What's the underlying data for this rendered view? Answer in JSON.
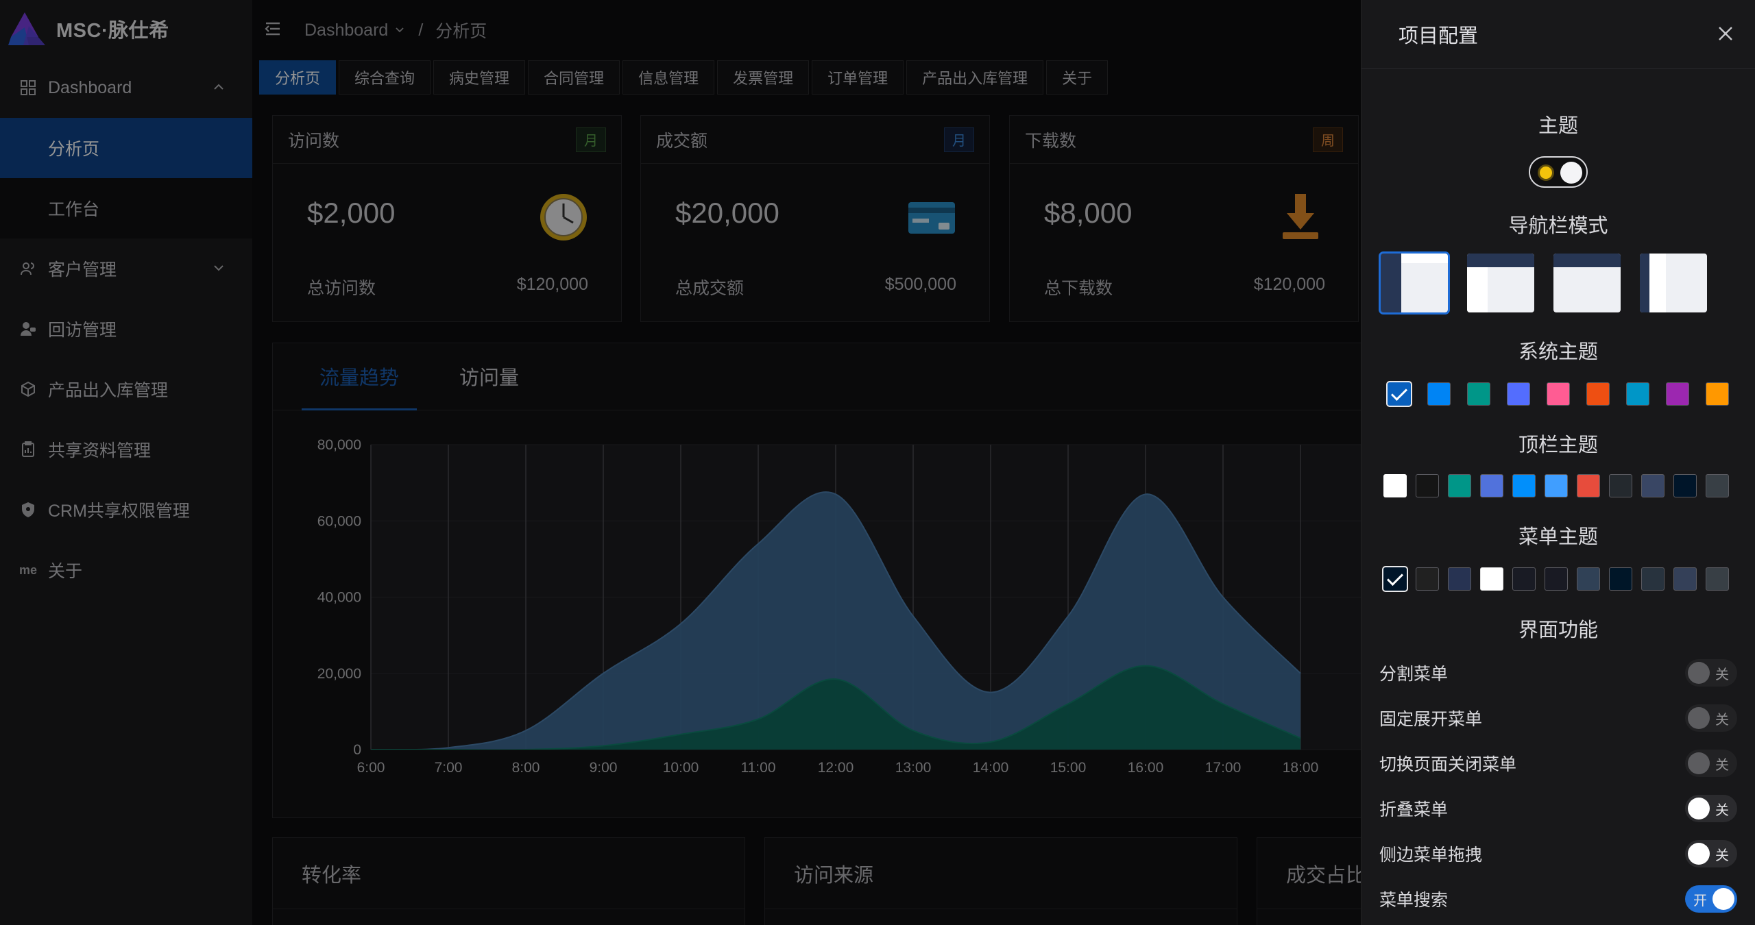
{
  "app": {
    "name": "MSC·脉仕希"
  },
  "sidebar": {
    "items": [
      {
        "label": "Dashboard",
        "icon": "grid-icon"
      },
      {
        "label": "分析页"
      },
      {
        "label": "工作台"
      },
      {
        "label": "客户管理",
        "icon": "user-group-icon"
      },
      {
        "label": "回访管理",
        "icon": "user-chat-icon"
      },
      {
        "label": "产品出入库管理",
        "icon": "box-icon"
      },
      {
        "label": "共享资料管理",
        "icon": "clipboard-icon"
      },
      {
        "label": "CRM共享权限管理",
        "icon": "shield-icon"
      },
      {
        "label": "关于",
        "icon_text": "me"
      }
    ]
  },
  "header": {
    "breadcrumb": [
      "Dashboard",
      "分析页"
    ],
    "separator": "/"
  },
  "tabs": [
    "分析页",
    "综合查询",
    "病史管理",
    "合同管理",
    "信息管理",
    "发票管理",
    "订单管理",
    "产品出入库管理",
    "关于"
  ],
  "stats": [
    {
      "title": "访问数",
      "badge": "月",
      "value": "$2,000",
      "foot_label": "总访问数",
      "foot_value": "$120,000",
      "color": "#5ba14b"
    },
    {
      "title": "成交额",
      "badge": "月",
      "value": "$20,000",
      "foot_label": "总成交额",
      "foot_value": "$500,000",
      "color": "#3a86d6"
    },
    {
      "title": "下载数",
      "badge": "周",
      "value": "$8,000",
      "foot_label": "总下载数",
      "foot_value": "$120,000",
      "color": "#d9843a"
    }
  ],
  "chart_tabs": [
    "流量趋势",
    "访问量"
  ],
  "bottom_cards": [
    "转化率",
    "访问来源",
    "成交占比"
  ],
  "chart_data": {
    "type": "area",
    "x": [
      "6:00",
      "7:00",
      "8:00",
      "9:00",
      "10:00",
      "11:00",
      "12:00",
      "13:00",
      "14:00",
      "15:00",
      "16:00",
      "17:00",
      "18:00"
    ],
    "ylim": [
      0,
      80000
    ],
    "yticks": [
      "0",
      "20,000",
      "40,000",
      "60,000",
      "80,000"
    ],
    "grid": true,
    "series": [
      {
        "values": [
          0,
          500,
          5000,
          20000,
          33000,
          54000,
          67000,
          35000,
          15000,
          35000,
          67000,
          40000,
          20000
        ],
        "color": "#3f6d99"
      },
      {
        "values": [
          0,
          0,
          0,
          1000,
          4000,
          8000,
          18500,
          5000,
          2000,
          12000,
          22000,
          12000,
          3000
        ],
        "color": "#0f6a5c"
      }
    ]
  },
  "drawer": {
    "title": "项目配置",
    "sections": {
      "theme": "主题",
      "nav_mode": "导航栏模式",
      "system_theme": "系统主题",
      "top_theme": "顶栏主题",
      "menu_theme": "菜单主题",
      "features": "界面功能"
    },
    "system_colors": [
      "#0960bd",
      "#0084f4",
      "#009688",
      "#536dfe",
      "#ff5c93",
      "#ee4f12",
      "#0096c7",
      "#9c27b0",
      "#ff9800"
    ],
    "top_colors": [
      "#ffffff",
      "#151515",
      "#009688",
      "#5172dc",
      "#018ffb",
      "#409eff",
      "#e74c3c",
      "#24292e",
      "#394664",
      "#001529",
      "#383f45"
    ],
    "menu_colors": [
      "#001529",
      "#212121",
      "#273352",
      "#ffffff",
      "#191b24",
      "#191a23",
      "#304156",
      "#001628",
      "#28333e",
      "#344058",
      "#383f45"
    ],
    "features": [
      {
        "label": "分割菜单",
        "state": "关",
        "on": false,
        "disabled": true
      },
      {
        "label": "固定展开菜单",
        "state": "关",
        "on": false,
        "disabled": true
      },
      {
        "label": "切换页面关闭菜单",
        "state": "关",
        "on": false,
        "disabled": true
      },
      {
        "label": "折叠菜单",
        "state": "关",
        "on": false,
        "disabled": false
      },
      {
        "label": "侧边菜单拖拽",
        "state": "关",
        "on": false,
        "disabled": false
      },
      {
        "label": "菜单搜索",
        "state": "开",
        "on": true,
        "disabled": false
      }
    ]
  }
}
